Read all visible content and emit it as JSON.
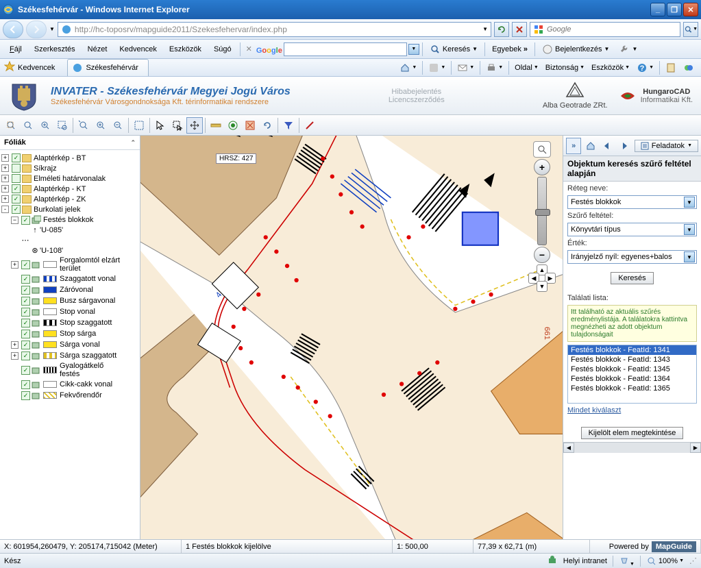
{
  "window": {
    "title": "Székesfehérvár - Windows Internet Explorer"
  },
  "nav": {
    "url": "http://hc-toposrv/mapguide2011/Szekesfehervar/index.php",
    "search_placeholder": "Google"
  },
  "menu": {
    "items": [
      "Fájl",
      "Szerkesztés",
      "Nézet",
      "Kedvencek",
      "Eszközök",
      "Súgó"
    ],
    "google": "Google",
    "keres": "Keresés",
    "egyebek": "Egyebek",
    "bejelentkezes": "Bejelentkezés"
  },
  "fav": {
    "kedvencek": "Kedvencek",
    "tab": "Székesfehérvár",
    "cmds": [
      "Oldal",
      "Biztonság",
      "Eszközök"
    ]
  },
  "header": {
    "title": "INVATER - Székesfehérvár Megyei Jogú Város",
    "subtitle": "Székesfehérvár Városgondnoksága Kft. térinformatikai rendszere",
    "links": [
      "Hibabejelentés",
      "Licencszerződés"
    ],
    "logo1": "Alba Geotrade ZRt.",
    "logo2a": "HungaroCAD",
    "logo2b": "Informatikai Kft."
  },
  "sidebar": {
    "title": "Fóliák",
    "layers": [
      {
        "exp": "+",
        "chk": true,
        "name": "Alaptérkép - BT"
      },
      {
        "exp": "+",
        "chk": false,
        "name": "Síkrajz"
      },
      {
        "exp": "+",
        "chk": false,
        "name": "Elméleti határvonalak"
      },
      {
        "exp": "+",
        "chk": true,
        "name": "Alaptérkép - KT"
      },
      {
        "exp": "+",
        "chk": true,
        "name": "Alaptérkép - ZK"
      },
      {
        "exp": "-",
        "chk": true,
        "name": "Burkolati jelek"
      }
    ],
    "festes": {
      "name": "Festés blokkok",
      "u085": "'U-085'",
      "u108": "'U-108'"
    },
    "sublayers": [
      {
        "exp": "+",
        "swatch": "#fff",
        "name": "Forgalomtól elzárt\nterület"
      },
      {
        "exp": "",
        "swatch": "dash-blue",
        "name": "Szaggatott vonal"
      },
      {
        "exp": "",
        "swatch": "#1040c0",
        "name": "Záróvonal"
      },
      {
        "exp": "",
        "swatch": "#ffe020",
        "name": "Busz sárgavonal"
      },
      {
        "exp": "",
        "swatch": "#fff",
        "name": "Stop vonal"
      },
      {
        "exp": "",
        "swatch": "dash-black",
        "name": "Stop szaggatott"
      },
      {
        "exp": "",
        "swatch": "#ffe020",
        "name": "Stop sárga"
      },
      {
        "exp": "+",
        "swatch": "#ffe020",
        "name": "Sárga vonal"
      },
      {
        "exp": "+",
        "swatch": "dash-yellow",
        "name": "Sárga szaggatott"
      },
      {
        "exp": "",
        "swatch": "hatch",
        "name": "Gyalogátkelő\nfestés"
      },
      {
        "exp": "",
        "swatch": "#fff",
        "name": "Cikk-cakk vonal"
      },
      {
        "exp": "",
        "swatch": "hatch-yellow",
        "name": "Fekvőrendőr"
      }
    ]
  },
  "map": {
    "hrsz_label": "HRSZ: 427",
    "num_661": "661"
  },
  "rightpanel": {
    "feladatok": "Feladatok",
    "title": "Objektum keresés szűrő feltétel alapján",
    "layer_label": "Réteg neve:",
    "layer_value": "Festés blokkok",
    "filter_label": "Szűrő feltétel:",
    "filter_value": "Könyvtári típus",
    "value_label": "Érték:",
    "value_value": "Irányjelző nyíl: egyenes+balos",
    "search_btn": "Keresés",
    "results_label": "Találati lista:",
    "results_help": "Itt található az aktuális szűrés eredménylistája. A találatokra kattintva megnézheti az adott objektum tulajdonságait",
    "results": [
      "Festés blokkok - FeatId: 1341",
      "Festés blokkok - FeatId: 1343",
      "Festés blokkok - FeatId: 1345",
      "Festés blokkok - FeatId: 1364",
      "Festés blokkok - FeatId: 1365"
    ],
    "select_all": "Mindet kiválaszt",
    "view_selected": "Kijelölt elem megtekintése"
  },
  "status1": {
    "coords": "X: 601954,260479, Y: 205174,715042 (Meter)",
    "selection": "1 Festés blokkok kijelölve",
    "scale": "1: 500,00",
    "extent": "77,39 x 62,71 (m)",
    "powered": "Powered by",
    "mapguide": "MapGuide"
  },
  "status2": {
    "ready": "Kész",
    "zone": "Helyi intranet",
    "zoom": "100%"
  }
}
